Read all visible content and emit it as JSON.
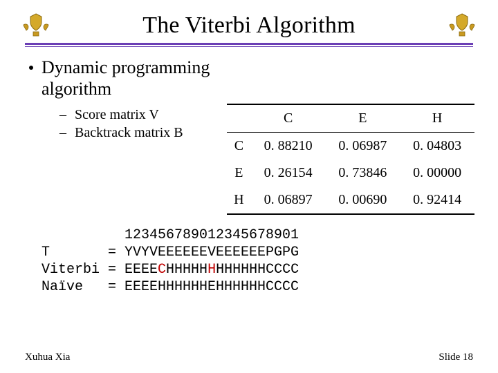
{
  "title": "The Viterbi Algorithm",
  "bullet": "Dynamic programming algorithm",
  "sub": {
    "a": "Score matrix V",
    "b": "Backtrack matrix B"
  },
  "table": {
    "cols": {
      "c0": "",
      "c1": "C",
      "c2": "E",
      "c3": "H"
    },
    "r0": {
      "h": "C",
      "c1": "0. 88210",
      "c2": "0. 06987",
      "c3": "0. 04803"
    },
    "r1": {
      "h": "E",
      "c1": "0. 26154",
      "c2": "0. 73846",
      "c3": "0. 00000"
    },
    "r2": {
      "h": "H",
      "c1": "0. 06897",
      "c2": "0. 00690",
      "c3": "0. 92414"
    }
  },
  "mono": {
    "ruler": "          123456789012345678901",
    "t": "T       = YVYVEEEEEEVEEEEEEPGPG",
    "v_pre": "Viterbi = EEEE",
    "v_hl1": "C",
    "v_mid": "HHHHH",
    "v_hl2": "H",
    "v_post": "HHHHHHCCCC",
    "naive": "Naïve   = EEEEHHHHHHEHHHHHHCCCC"
  },
  "footer": {
    "author": "Xuhua Xia",
    "slide": "Slide 18"
  }
}
